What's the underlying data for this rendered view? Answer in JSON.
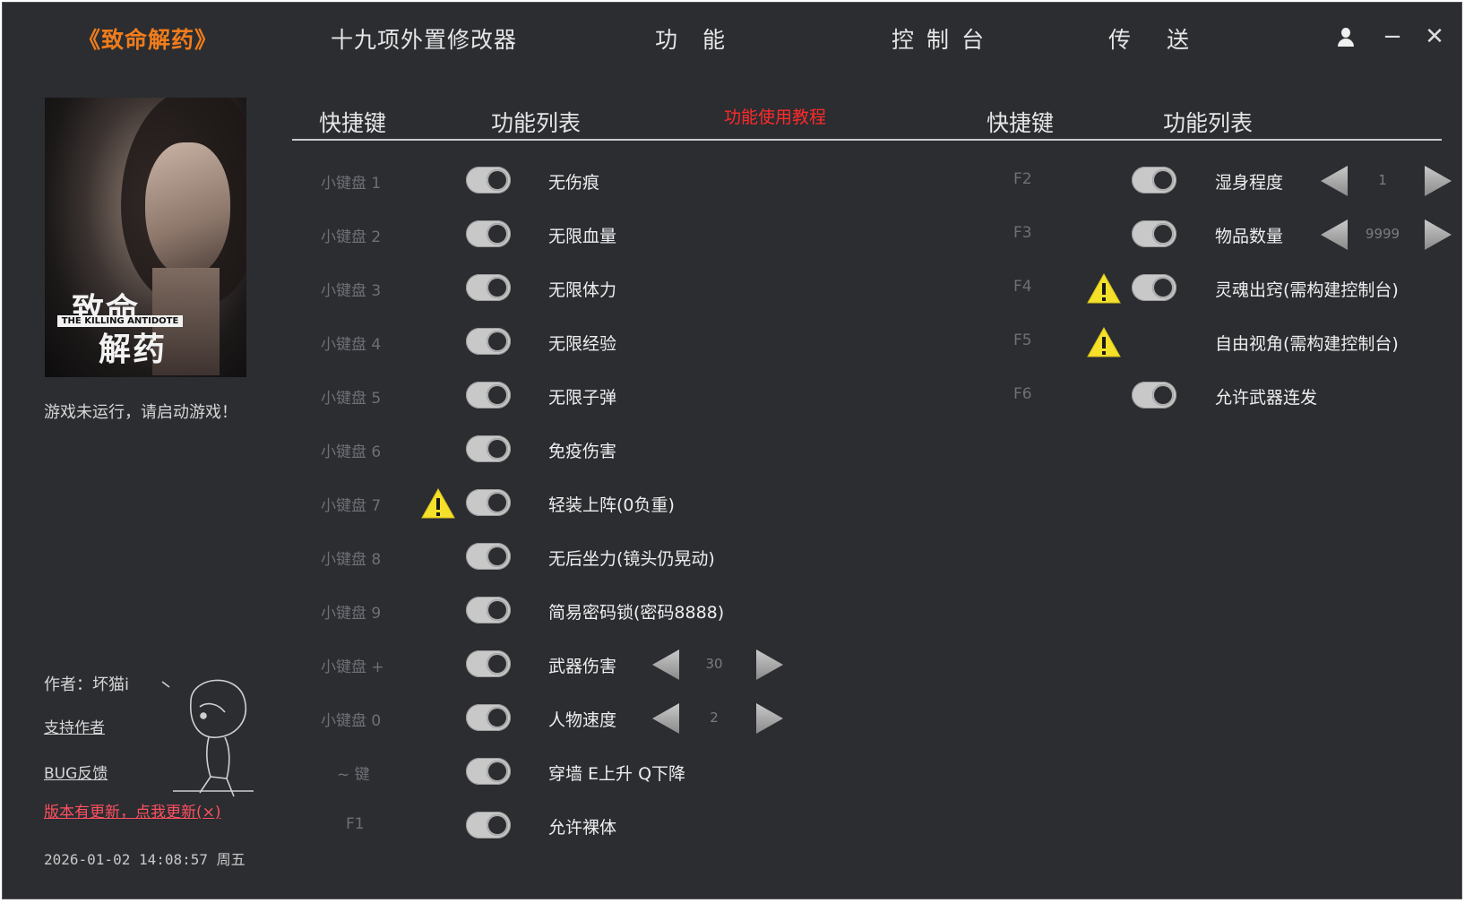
{
  "topbar": {
    "game_title": "《致命解药》",
    "app_title": "十九项外置修改器",
    "nav_features": "功能",
    "nav_console": "控制台",
    "nav_teleport": "传送",
    "minimize": "−",
    "close": "✕"
  },
  "sidebar": {
    "cover_title_1": "致命",
    "cover_subtitle": "THE KILLING ANTIDOTE",
    "cover_title_2": "解药",
    "status": "游戏未运行，请启动游戏！",
    "author": "作者：坏猫i",
    "support": "支持作者",
    "bug": "BUG反馈",
    "update": "版本有更新，点我更新(×)",
    "datetime": "2026-01-02 14:08:57 周五"
  },
  "tabs": {
    "left_hotkey": "快捷键",
    "left_features": "功能列表",
    "tutorial": "功能使用教程",
    "right_hotkey": "快捷键",
    "right_features": "功能列表"
  },
  "left_rows": [
    {
      "key": "小键盘 1",
      "label": "无伤痕",
      "warn": false
    },
    {
      "key": "小键盘 2",
      "label": "无限血量",
      "warn": false
    },
    {
      "key": "小键盘 3",
      "label": "无限体力",
      "warn": false
    },
    {
      "key": "小键盘 4",
      "label": "无限经验",
      "warn": false
    },
    {
      "key": "小键盘 5",
      "label": "无限子弹",
      "warn": false
    },
    {
      "key": "小键盘 6",
      "label": "免疫伤害",
      "warn": false
    },
    {
      "key": "小键盘 7",
      "label": "轻装上阵(0负重)",
      "warn": true
    },
    {
      "key": "小键盘 8",
      "label": "无后坐力(镜头仍晃动)",
      "warn": false
    },
    {
      "key": "小键盘 9",
      "label": "简易密码锁(密码8888)",
      "warn": false
    },
    {
      "key": "小键盘 +",
      "label": "武器伤害",
      "warn": false,
      "value": "30"
    },
    {
      "key": "小键盘 0",
      "label": "人物速度",
      "warn": false,
      "value": "2"
    },
    {
      "key": "~ 键",
      "label": "穿墙 E上升 Q下降",
      "warn": false
    },
    {
      "key": "F1",
      "label": "允许裸体",
      "warn": false
    }
  ],
  "right_rows": [
    {
      "key": "F2",
      "label": "湿身程度",
      "warn": false,
      "toggle": true,
      "value": "1"
    },
    {
      "key": "F3",
      "label": "物品数量",
      "warn": false,
      "toggle": true,
      "value": "9999"
    },
    {
      "key": "F4",
      "label": "灵魂出窍(需构建控制台)",
      "warn": true,
      "toggle": true
    },
    {
      "key": "F5",
      "label": "自由视角(需构建控制台)",
      "warn": true,
      "toggle": false
    },
    {
      "key": "F6",
      "label": "允许武器连发",
      "warn": false,
      "toggle": true
    }
  ],
  "colors": {
    "background": "#2b2d31",
    "accent_orange": "#f07c1b",
    "tutorial_red": "#ff2a2a",
    "update_pink": "#ff5060",
    "warning_yellow": "#f5e02a"
  }
}
